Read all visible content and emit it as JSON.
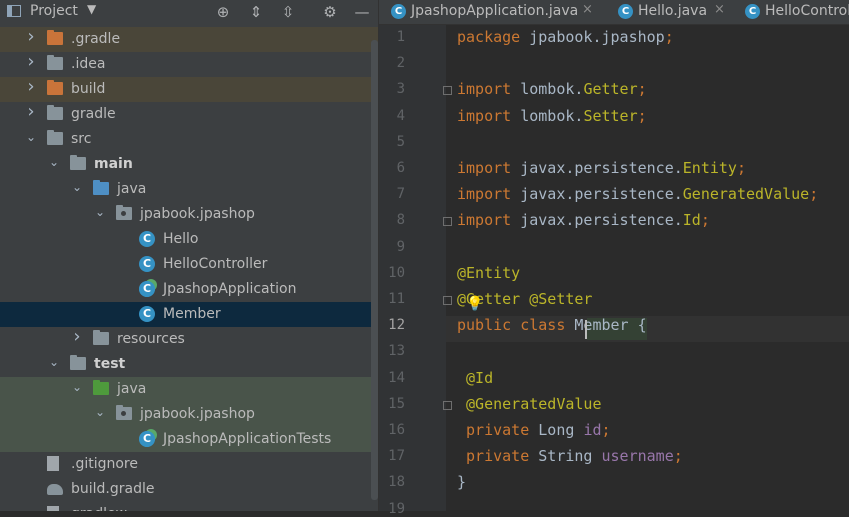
{
  "project_panel": {
    "title": "Project",
    "dropdown_glyph": "▼",
    "header_icons": [
      {
        "name": "locate-icon",
        "glyph": "⊕"
      },
      {
        "name": "expand-all-icon",
        "glyph": "⇕"
      },
      {
        "name": "collapse-all-icon",
        "glyph": "⇳"
      },
      {
        "name": "settings-icon",
        "glyph": "⚙"
      },
      {
        "name": "hide-icon",
        "glyph": "—"
      }
    ],
    "tree": [
      {
        "label": ".gradle",
        "depth": 0,
        "expanded": false,
        "icon": "folder-orange",
        "highlight": "#4a4639"
      },
      {
        "label": ".idea",
        "depth": 0,
        "expanded": false,
        "icon": "folder-grey",
        "highlight": ""
      },
      {
        "label": "build",
        "depth": 0,
        "expanded": false,
        "icon": "folder-orange",
        "highlight": "#4a4639"
      },
      {
        "label": "gradle",
        "depth": 0,
        "expanded": false,
        "icon": "folder-grey",
        "highlight": ""
      },
      {
        "label": "src",
        "depth": 0,
        "expanded": true,
        "icon": "folder-grey",
        "highlight": ""
      },
      {
        "label": "main",
        "depth": 1,
        "expanded": true,
        "icon": "folder-module",
        "bold": true,
        "highlight": ""
      },
      {
        "label": "java",
        "depth": 2,
        "expanded": true,
        "icon": "folder-blue",
        "highlight": ""
      },
      {
        "label": "jpabook.jpashop",
        "depth": 3,
        "expanded": true,
        "icon": "package",
        "highlight": ""
      },
      {
        "label": "Hello",
        "depth": 4,
        "icon": "class",
        "highlight": ""
      },
      {
        "label": "HelloController",
        "depth": 4,
        "icon": "class",
        "highlight": ""
      },
      {
        "label": "JpashopApplication",
        "depth": 4,
        "icon": "class-run",
        "highlight": ""
      },
      {
        "label": "Member",
        "depth": 4,
        "icon": "class",
        "highlight": "#0d293e",
        "selected": true
      },
      {
        "label": "resources",
        "depth": 2,
        "expanded": false,
        "icon": "folder-resources",
        "highlight": ""
      },
      {
        "label": "test",
        "depth": 1,
        "expanded": true,
        "icon": "folder-module",
        "bold": true,
        "highlight": ""
      },
      {
        "label": "java",
        "depth": 2,
        "expanded": true,
        "icon": "folder-green",
        "highlight": "#49544a"
      },
      {
        "label": "jpabook.jpashop",
        "depth": 3,
        "expanded": true,
        "icon": "package",
        "highlight": "#49544a"
      },
      {
        "label": "JpashopApplicationTests",
        "depth": 4,
        "icon": "class-run",
        "highlight": "#49544a"
      },
      {
        "label": ".gitignore",
        "depth": 0,
        "icon": "file",
        "highlight": ""
      },
      {
        "label": "build.gradle",
        "depth": 0,
        "icon": "gradle",
        "highlight": ""
      },
      {
        "label": "gradlew",
        "depth": 0,
        "icon": "file",
        "highlight": ""
      }
    ]
  },
  "tabs": [
    {
      "label": "JpashopApplication.java",
      "closable": true
    },
    {
      "label": "Hello.java",
      "closable": true
    },
    {
      "label": "HelloController.java",
      "closable": false
    }
  ],
  "editor": {
    "current_line": 12,
    "lines": [
      {
        "n": "1",
        "tokens": [
          [
            "kw",
            "package "
          ],
          [
            "",
            "jpabook.jpashop"
          ],
          [
            "kw",
            ";"
          ]
        ]
      },
      {
        "n": "2",
        "tokens": []
      },
      {
        "n": "3",
        "fold": true,
        "tokens": [
          [
            "kw",
            "import "
          ],
          [
            "",
            "lombok."
          ],
          [
            "ann",
            "Getter"
          ],
          [
            "kw",
            ";"
          ]
        ]
      },
      {
        "n": "4",
        "tokens": [
          [
            "kw",
            "import "
          ],
          [
            "",
            "lombok."
          ],
          [
            "ann",
            "Setter"
          ],
          [
            "kw",
            ";"
          ]
        ]
      },
      {
        "n": "5",
        "tokens": []
      },
      {
        "n": "6",
        "tokens": [
          [
            "kw",
            "import "
          ],
          [
            "",
            "javax.persistence."
          ],
          [
            "ann",
            "Entity"
          ],
          [
            "kw",
            ";"
          ]
        ]
      },
      {
        "n": "7",
        "tokens": [
          [
            "kw",
            "import "
          ],
          [
            "",
            "javax.persistence."
          ],
          [
            "ann",
            "GeneratedValue"
          ],
          [
            "kw",
            ";"
          ]
        ]
      },
      {
        "n": "8",
        "fold": true,
        "tokens": [
          [
            "kw",
            "import "
          ],
          [
            "",
            "javax.persistence."
          ],
          [
            "ann",
            "Id"
          ],
          [
            "kw",
            ";"
          ]
        ]
      },
      {
        "n": "9",
        "tokens": []
      },
      {
        "n": "10",
        "tokens": [
          [
            "ann",
            "@Entity"
          ]
        ]
      },
      {
        "n": "11",
        "fold": true,
        "tokens": [
          [
            "ann",
            "@Getter"
          ],
          [
            "",
            " "
          ],
          [
            "ann",
            "@Setter"
          ]
        ]
      },
      {
        "n": "12",
        "tokens": [
          [
            "kw",
            "public class "
          ],
          [
            "",
            "Member {"
          ]
        ]
      },
      {
        "n": "13",
        "tokens": []
      },
      {
        "n": "14",
        "tokens": [
          [
            "",
            " "
          ],
          [
            "ann",
            "@Id"
          ]
        ]
      },
      {
        "n": "15",
        "fold": true,
        "tokens": [
          [
            "",
            " "
          ],
          [
            "ann",
            "@GeneratedValue"
          ]
        ]
      },
      {
        "n": "16",
        "tokens": [
          [
            "",
            " "
          ],
          [
            "kw",
            "private "
          ],
          [
            "",
            "Long "
          ],
          [
            "fld",
            "id"
          ],
          [
            "kw",
            ";"
          ]
        ]
      },
      {
        "n": "17",
        "tokens": [
          [
            "",
            " "
          ],
          [
            "kw",
            "private "
          ],
          [
            "",
            "String "
          ],
          [
            "fld",
            "username"
          ],
          [
            "kw",
            ";"
          ]
        ]
      },
      {
        "n": "18",
        "tokens": [
          [
            "",
            "}"
          ]
        ]
      },
      {
        "n": "19",
        "tokens": []
      }
    ]
  }
}
